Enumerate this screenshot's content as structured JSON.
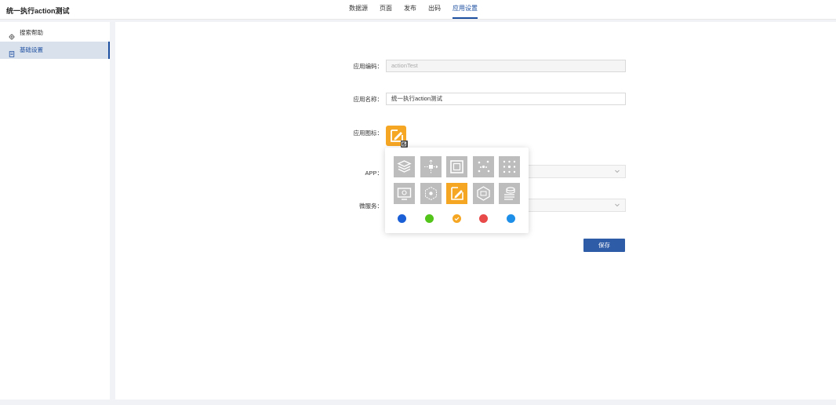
{
  "header": {
    "app_title": "统一执行action测试",
    "tabs": [
      {
        "label": "数据源"
      },
      {
        "label": "页面"
      },
      {
        "label": "发布"
      },
      {
        "label": "出码"
      },
      {
        "label": "应用设置"
      }
    ],
    "active_tab": "应用设置"
  },
  "sidebar": {
    "items": [
      {
        "label": "搜索帮助",
        "icon": "gear-icon"
      },
      {
        "label": "基础设置",
        "icon": "document-icon"
      }
    ],
    "active_item": "基础设置"
  },
  "form": {
    "app_code_label": "应用编码：",
    "app_code_value": "actionTest",
    "app_name_label": "应用名称：",
    "app_name_value": "统一执行action测试",
    "app_icon_label": "应用图标：",
    "app_label": "APP：",
    "microservice_label": "微服务：",
    "save_label": "保存"
  },
  "icon_picker": {
    "icons": [
      "layers-icon",
      "move-arrows-icon",
      "frame-icon",
      "scatter-nodes-icon",
      "network-grid-icon",
      "monitor-settings-icon",
      "hexagon-network-icon",
      "edit-box-icon",
      "cube-icon",
      "database-flow-icon"
    ],
    "selected_icon": "edit-box-icon",
    "colors": [
      "#1a5fd6",
      "#52c41a",
      "#f5a623",
      "#e84a4a",
      "#1e8fe8"
    ],
    "selected_color": "#f5a623",
    "selected_bg": "#f5a623",
    "default_bg": "#bdbdbd"
  }
}
